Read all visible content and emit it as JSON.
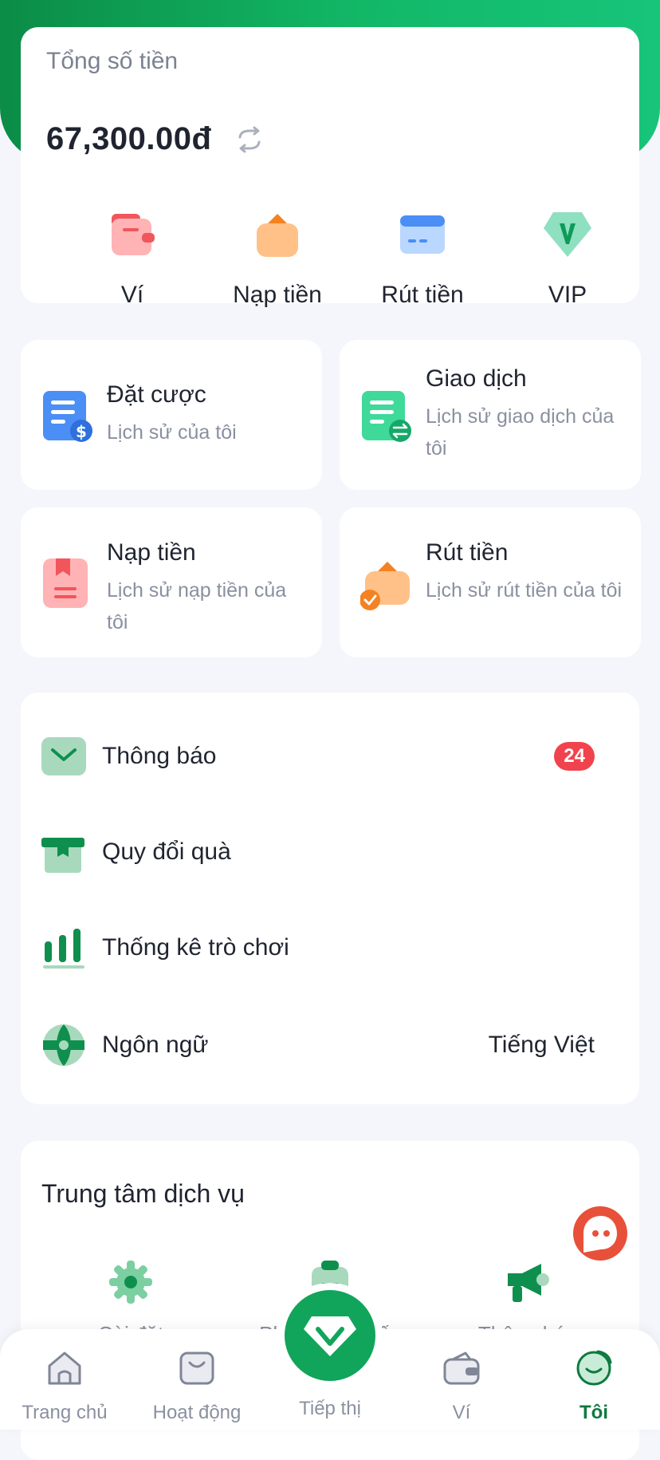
{
  "balance": {
    "label": "Tổng số tiền",
    "amount": "67,300.00đ"
  },
  "quick_actions": [
    {
      "label": "Ví",
      "icon": "wallet-icon"
    },
    {
      "label": "Nạp tiền",
      "icon": "deposit-icon"
    },
    {
      "label": "Rút tiền",
      "icon": "withdraw-card-icon"
    },
    {
      "label": "VIP",
      "icon": "vip-icon"
    }
  ],
  "history": [
    {
      "title": "Đặt cược",
      "subtitle": "Lịch sử của tôi",
      "icon": "bet-history-icon"
    },
    {
      "title": "Giao dịch",
      "subtitle": "Lịch sử giao dịch của tôi",
      "icon": "transaction-history-icon"
    },
    {
      "title": "Nạp tiền",
      "subtitle": "Lịch sử nạp tiền của tôi",
      "icon": "deposit-history-icon"
    },
    {
      "title": "Rút tiền",
      "subtitle": "Lịch sử rút tiền của tôi",
      "icon": "withdraw-history-icon"
    }
  ],
  "menu": [
    {
      "label": "Thông báo",
      "badge": "24",
      "icon": "mail-icon"
    },
    {
      "label": "Quy đổi quà",
      "icon": "gift-icon"
    },
    {
      "label": "Thống kê trò chơi",
      "icon": "stats-icon"
    },
    {
      "label": "Ngôn ngữ",
      "value": "Tiếng Việt",
      "icon": "globe-icon"
    }
  ],
  "service_center": {
    "title": "Trung tâm dịch vụ",
    "items": [
      {
        "label": "Cài đặt",
        "icon": "settings-icon"
      },
      {
        "label": "Phản hồi ý kiến",
        "icon": "feedback-icon"
      },
      {
        "label": "Thông báo",
        "icon": "announcement-icon"
      }
    ]
  },
  "bottom_nav": [
    {
      "label": "Trang chủ",
      "icon": "home-icon"
    },
    {
      "label": "Hoạt động",
      "icon": "activity-icon"
    },
    {
      "label": "Tiếp thị",
      "icon": "diamond-icon"
    },
    {
      "label": "Ví",
      "icon": "wallet-icon"
    },
    {
      "label": "Tôi",
      "icon": "profile-icon",
      "active": true
    }
  ],
  "colors": {
    "brand_green": "#10a55a",
    "badge_red": "#f0434d",
    "active_nav": "#0e7a3f"
  }
}
